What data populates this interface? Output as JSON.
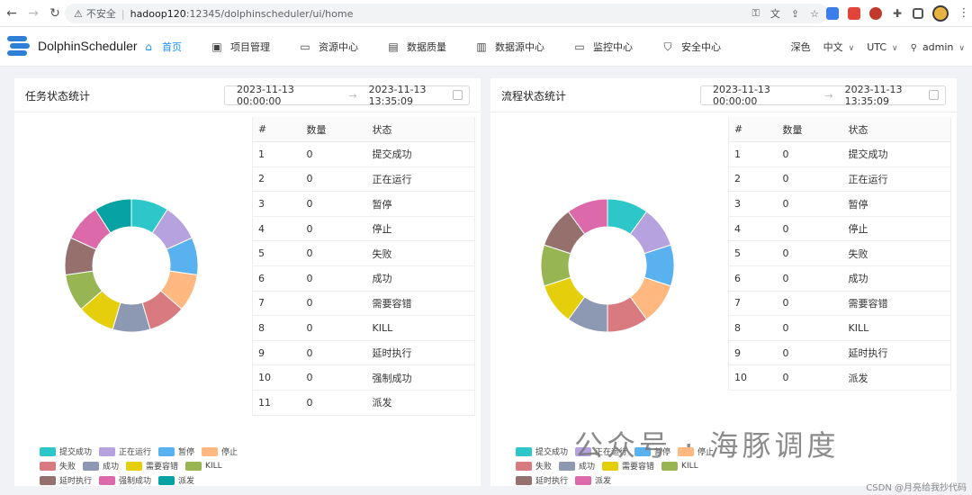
{
  "browser": {
    "warn_icon": "warning-icon",
    "security_label": "不安全",
    "host": "hadoop120",
    "path": ":12345/dolphinscheduler/ui/home"
  },
  "app": {
    "name": "DolphinScheduler",
    "menu": [
      {
        "label": "首页",
        "icon": "home-icon",
        "active": true
      },
      {
        "label": "项目管理",
        "icon": "project-icon",
        "active": false
      },
      {
        "label": "资源中心",
        "icon": "folder-icon",
        "active": false
      },
      {
        "label": "数据质量",
        "icon": "clipboard-icon",
        "active": false
      },
      {
        "label": "数据源中心",
        "icon": "datasource-icon",
        "active": false
      },
      {
        "label": "监控中心",
        "icon": "monitor-icon",
        "active": false
      },
      {
        "label": "安全中心",
        "icon": "shield-icon",
        "active": false
      }
    ],
    "theme_label": "深色",
    "language_label": "中文",
    "timezone_label": "UTC",
    "user_label": "admin"
  },
  "task_panel": {
    "title": "任务状态统计",
    "start_date": "2023-11-13 00:00:00",
    "end_date": "2023-11-13 13:35:09",
    "columns": [
      "#",
      "数量",
      "状态"
    ],
    "rows": [
      [
        "1",
        "0",
        "提交成功"
      ],
      [
        "2",
        "0",
        "正在运行"
      ],
      [
        "3",
        "0",
        "暂停"
      ],
      [
        "4",
        "0",
        "停止"
      ],
      [
        "5",
        "0",
        "失败"
      ],
      [
        "6",
        "0",
        "成功"
      ],
      [
        "7",
        "0",
        "需要容错"
      ],
      [
        "8",
        "0",
        "KILL"
      ],
      [
        "9",
        "0",
        "延时执行"
      ],
      [
        "10",
        "0",
        "强制成功"
      ],
      [
        "11",
        "0",
        "派发"
      ]
    ],
    "legend": [
      "提交成功",
      "正在运行",
      "暂停",
      "停止",
      "失败",
      "成功",
      "需要容错",
      "KILL",
      "延时执行",
      "强制成功",
      "派发"
    ]
  },
  "process_panel": {
    "title": "流程状态统计",
    "start_date": "2023-11-13 00:00:00",
    "end_date": "2023-11-13 13:35:09",
    "columns": [
      "#",
      "数量",
      "状态"
    ],
    "rows": [
      [
        "1",
        "0",
        "提交成功"
      ],
      [
        "2",
        "0",
        "正在运行"
      ],
      [
        "3",
        "0",
        "暂停"
      ],
      [
        "4",
        "0",
        "停止"
      ],
      [
        "5",
        "0",
        "失败"
      ],
      [
        "6",
        "0",
        "成功"
      ],
      [
        "7",
        "0",
        "需要容错"
      ],
      [
        "8",
        "0",
        "KILL"
      ],
      [
        "9",
        "0",
        "延时执行"
      ],
      [
        "10",
        "0",
        "派发"
      ]
    ],
    "legend": [
      "提交成功",
      "正在运行",
      "暂停",
      "停止",
      "失败",
      "成功",
      "需要容错",
      "KILL",
      "延时执行",
      "派发"
    ]
  },
  "colors": {
    "task": [
      "#2ec7c9",
      "#b6a2de",
      "#5ab1ef",
      "#ffb980",
      "#d87a80",
      "#8d98b3",
      "#e5cf0d",
      "#97b552",
      "#95706d",
      "#dc69aa",
      "#07a2a4"
    ],
    "process": [
      "#2ec7c9",
      "#b6a2de",
      "#5ab1ef",
      "#ffb980",
      "#d87a80",
      "#8d98b3",
      "#e5cf0d",
      "#97b552",
      "#95706d",
      "#dc69aa"
    ],
    "accent": "#1890ff"
  },
  "watermark": {
    "text": "公众号 · 海豚调度",
    "credit": "CSDN @月亮给我抄代码"
  }
}
